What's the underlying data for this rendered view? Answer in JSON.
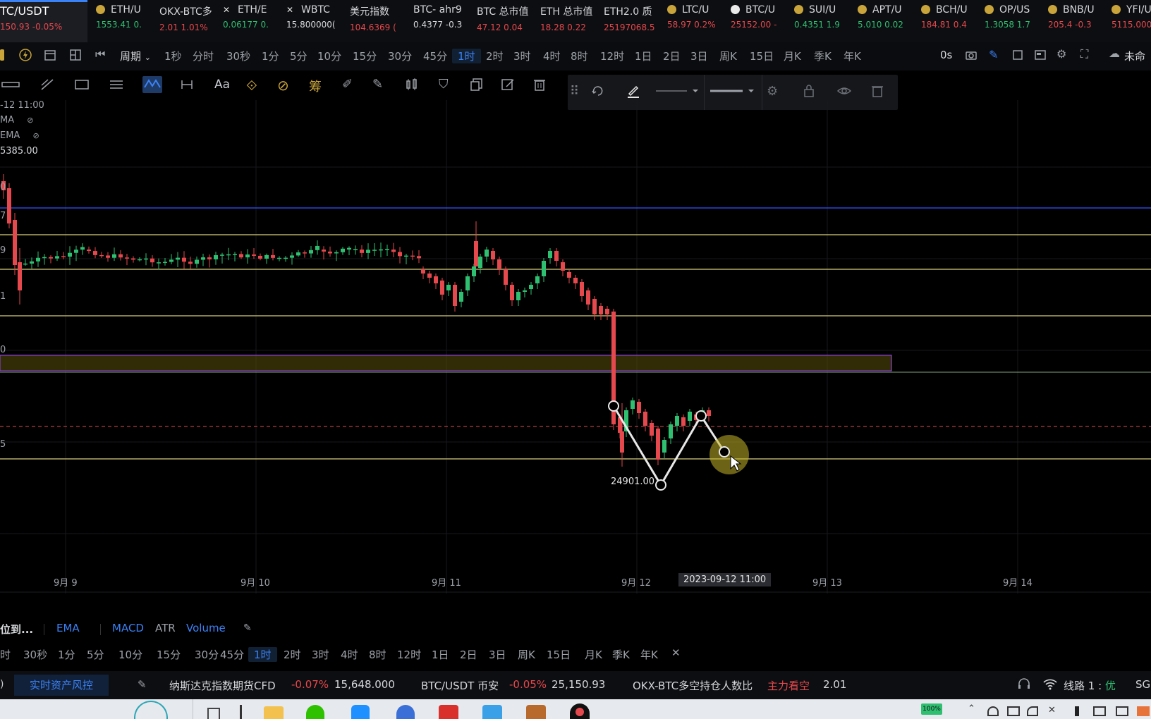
{
  "tickers": [
    {
      "name": "TC/USDT",
      "val": "150.93 -0.05%",
      "dir": "down",
      "icon": "none"
    },
    {
      "name": "ETH/U",
      "val": "1553.41 0.",
      "dir": "up",
      "icon": "coin-icon"
    },
    {
      "name": "OKX-BTC多",
      "val": "2.01 1.01%",
      "dir": "down",
      "icon": "none"
    },
    {
      "name": "ETH/E",
      "val": "0.06177 0.",
      "dir": "up",
      "icon": "x-icon"
    },
    {
      "name": "WBTC",
      "val": "15.800000(",
      "dir": "plain",
      "icon": "x-icon"
    },
    {
      "name": "美元指数",
      "val": "104.6369 (",
      "dir": "down",
      "icon": "none"
    },
    {
      "name": "BTC- ahr9",
      "val": "0.4377 -0.3",
      "dir": "plain",
      "icon": "none"
    },
    {
      "name": "BTC 总市值",
      "val": "47.12 0.04",
      "dir": "down",
      "icon": "none"
    },
    {
      "name": "ETH 总市值",
      "val": "18.28 0.22",
      "dir": "down",
      "icon": "none"
    },
    {
      "name": "ETH2.0 质",
      "val": "25197068.5",
      "dir": "down",
      "icon": "none"
    },
    {
      "name": "LTC/U",
      "val": "58.97 0.2%",
      "dir": "down",
      "icon": "coin-icon"
    },
    {
      "name": "BTC/U",
      "val": "25152.00 -",
      "dir": "down",
      "icon": "flame-icon"
    },
    {
      "name": "SUI/U",
      "val": "0.4351 1.9",
      "dir": "up",
      "icon": "coin-icon"
    },
    {
      "name": "APT/U",
      "val": "5.010 0.02",
      "dir": "up",
      "icon": "coin-icon"
    },
    {
      "name": "BCH/U",
      "val": "184.81 0.4",
      "dir": "down",
      "icon": "coin-icon"
    },
    {
      "name": "OP/US",
      "val": "1.3058 1.7",
      "dir": "up",
      "icon": "coin-icon"
    },
    {
      "name": "BNB/U",
      "val": "205.4 -0.3",
      "dir": "down",
      "icon": "coin-icon"
    },
    {
      "name": "YFI/U",
      "val": "5115.000",
      "dir": "down",
      "icon": "coin-icon"
    }
  ],
  "period_bar": {
    "period_label": "周期",
    "items": [
      "1秒",
      "分时",
      "30秒",
      "1分",
      "5分",
      "10分",
      "15分",
      "30分",
      "45分",
      "1时",
      "2时",
      "3时",
      "4时",
      "8时",
      "12时",
      "1日",
      "2日",
      "3日",
      "周K",
      "15日",
      "月K",
      "季K",
      "年K"
    ],
    "active": "1时",
    "countdown": "0s",
    "cloud_label": "未命"
  },
  "draw_toolbar": {
    "text_tool": "Aa"
  },
  "chart": {
    "legend_time": "-12 11:00",
    "legend_ma": "MA",
    "legend_ema": "EMA",
    "legend_price": "5385.00",
    "price_marks": [
      "0",
      "7",
      "9",
      "1",
      "0",
      "5"
    ],
    "low_label": "24901.00",
    "date_labels": [
      "9月 9",
      "9月 10",
      "9月 11",
      "9月 12",
      "9月 13",
      "9月 14"
    ],
    "crosshair_time": "2023-09-12 11:00"
  },
  "indicator_bar": {
    "position_label": "位到...",
    "items": [
      "EMA",
      "MACD",
      "ATR",
      "Volume"
    ]
  },
  "period_bar2": {
    "items": [
      "时",
      "30秒",
      "1分",
      "5分",
      "10分",
      "15分",
      "30分",
      "45分",
      "1时",
      "2时",
      "3时",
      "4时",
      "8时",
      "12时",
      "1日",
      "2日",
      "3日",
      "周K",
      "15日",
      "月K",
      "季K",
      "年K"
    ],
    "active": "1时"
  },
  "status_bar": {
    "risk_button": "实时资产风控",
    "nasdaq_name": "纳斯达克指数期货CFD",
    "nasdaq_change": "-0.07%",
    "nasdaq_price": "15,648.000",
    "btc_name": "BTC/USDT 币安",
    "btc_change": "-0.05%",
    "btc_price": "25,150.93",
    "okx_name": "OKX-BTC多空持仓人数比",
    "okx_signal": "主力看空",
    "okx_value": "2.01",
    "line_label": "线路 1 : ",
    "line_quality": "优",
    "region": "SG"
  },
  "taskbar": {
    "battery": "100%"
  },
  "colors": {
    "up": "#2fbf71",
    "down": "#e5484d",
    "accent": "#3b82f6",
    "hline": "#d8d07a",
    "blue_line": "#3355ff",
    "box": "#8a3fd0"
  }
}
